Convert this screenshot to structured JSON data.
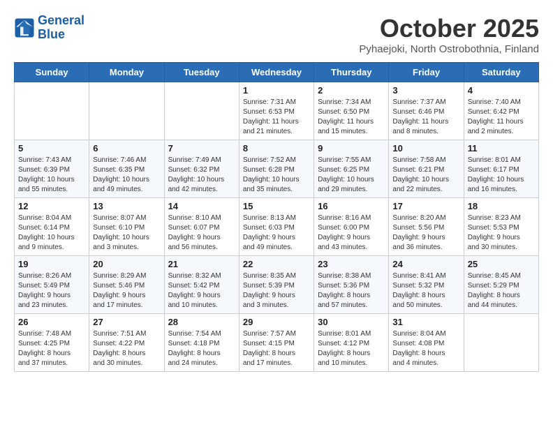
{
  "header": {
    "logo_line1": "General",
    "logo_line2": "Blue",
    "month": "October 2025",
    "location": "Pyhaejoki, North Ostrobothnia, Finland"
  },
  "days_of_week": [
    "Sunday",
    "Monday",
    "Tuesday",
    "Wednesday",
    "Thursday",
    "Friday",
    "Saturday"
  ],
  "weeks": [
    [
      {
        "day": "",
        "info": ""
      },
      {
        "day": "",
        "info": ""
      },
      {
        "day": "",
        "info": ""
      },
      {
        "day": "1",
        "info": "Sunrise: 7:31 AM\nSunset: 6:53 PM\nDaylight: 11 hours\nand 21 minutes."
      },
      {
        "day": "2",
        "info": "Sunrise: 7:34 AM\nSunset: 6:50 PM\nDaylight: 11 hours\nand 15 minutes."
      },
      {
        "day": "3",
        "info": "Sunrise: 7:37 AM\nSunset: 6:46 PM\nDaylight: 11 hours\nand 8 minutes."
      },
      {
        "day": "4",
        "info": "Sunrise: 7:40 AM\nSunset: 6:42 PM\nDaylight: 11 hours\nand 2 minutes."
      }
    ],
    [
      {
        "day": "5",
        "info": "Sunrise: 7:43 AM\nSunset: 6:39 PM\nDaylight: 10 hours\nand 55 minutes."
      },
      {
        "day": "6",
        "info": "Sunrise: 7:46 AM\nSunset: 6:35 PM\nDaylight: 10 hours\nand 49 minutes."
      },
      {
        "day": "7",
        "info": "Sunrise: 7:49 AM\nSunset: 6:32 PM\nDaylight: 10 hours\nand 42 minutes."
      },
      {
        "day": "8",
        "info": "Sunrise: 7:52 AM\nSunset: 6:28 PM\nDaylight: 10 hours\nand 35 minutes."
      },
      {
        "day": "9",
        "info": "Sunrise: 7:55 AM\nSunset: 6:25 PM\nDaylight: 10 hours\nand 29 minutes."
      },
      {
        "day": "10",
        "info": "Sunrise: 7:58 AM\nSunset: 6:21 PM\nDaylight: 10 hours\nand 22 minutes."
      },
      {
        "day": "11",
        "info": "Sunrise: 8:01 AM\nSunset: 6:17 PM\nDaylight: 10 hours\nand 16 minutes."
      }
    ],
    [
      {
        "day": "12",
        "info": "Sunrise: 8:04 AM\nSunset: 6:14 PM\nDaylight: 10 hours\nand 9 minutes."
      },
      {
        "day": "13",
        "info": "Sunrise: 8:07 AM\nSunset: 6:10 PM\nDaylight: 10 hours\nand 3 minutes."
      },
      {
        "day": "14",
        "info": "Sunrise: 8:10 AM\nSunset: 6:07 PM\nDaylight: 9 hours\nand 56 minutes."
      },
      {
        "day": "15",
        "info": "Sunrise: 8:13 AM\nSunset: 6:03 PM\nDaylight: 9 hours\nand 49 minutes."
      },
      {
        "day": "16",
        "info": "Sunrise: 8:16 AM\nSunset: 6:00 PM\nDaylight: 9 hours\nand 43 minutes."
      },
      {
        "day": "17",
        "info": "Sunrise: 8:20 AM\nSunset: 5:56 PM\nDaylight: 9 hours\nand 36 minutes."
      },
      {
        "day": "18",
        "info": "Sunrise: 8:23 AM\nSunset: 5:53 PM\nDaylight: 9 hours\nand 30 minutes."
      }
    ],
    [
      {
        "day": "19",
        "info": "Sunrise: 8:26 AM\nSunset: 5:49 PM\nDaylight: 9 hours\nand 23 minutes."
      },
      {
        "day": "20",
        "info": "Sunrise: 8:29 AM\nSunset: 5:46 PM\nDaylight: 9 hours\nand 17 minutes."
      },
      {
        "day": "21",
        "info": "Sunrise: 8:32 AM\nSunset: 5:42 PM\nDaylight: 9 hours\nand 10 minutes."
      },
      {
        "day": "22",
        "info": "Sunrise: 8:35 AM\nSunset: 5:39 PM\nDaylight: 9 hours\nand 3 minutes."
      },
      {
        "day": "23",
        "info": "Sunrise: 8:38 AM\nSunset: 5:36 PM\nDaylight: 8 hours\nand 57 minutes."
      },
      {
        "day": "24",
        "info": "Sunrise: 8:41 AM\nSunset: 5:32 PM\nDaylight: 8 hours\nand 50 minutes."
      },
      {
        "day": "25",
        "info": "Sunrise: 8:45 AM\nSunset: 5:29 PM\nDaylight: 8 hours\nand 44 minutes."
      }
    ],
    [
      {
        "day": "26",
        "info": "Sunrise: 7:48 AM\nSunset: 4:25 PM\nDaylight: 8 hours\nand 37 minutes."
      },
      {
        "day": "27",
        "info": "Sunrise: 7:51 AM\nSunset: 4:22 PM\nDaylight: 8 hours\nand 30 minutes."
      },
      {
        "day": "28",
        "info": "Sunrise: 7:54 AM\nSunset: 4:18 PM\nDaylight: 8 hours\nand 24 minutes."
      },
      {
        "day": "29",
        "info": "Sunrise: 7:57 AM\nSunset: 4:15 PM\nDaylight: 8 hours\nand 17 minutes."
      },
      {
        "day": "30",
        "info": "Sunrise: 8:01 AM\nSunset: 4:12 PM\nDaylight: 8 hours\nand 10 minutes."
      },
      {
        "day": "31",
        "info": "Sunrise: 8:04 AM\nSunset: 4:08 PM\nDaylight: 8 hours\nand 4 minutes."
      },
      {
        "day": "",
        "info": ""
      }
    ]
  ]
}
